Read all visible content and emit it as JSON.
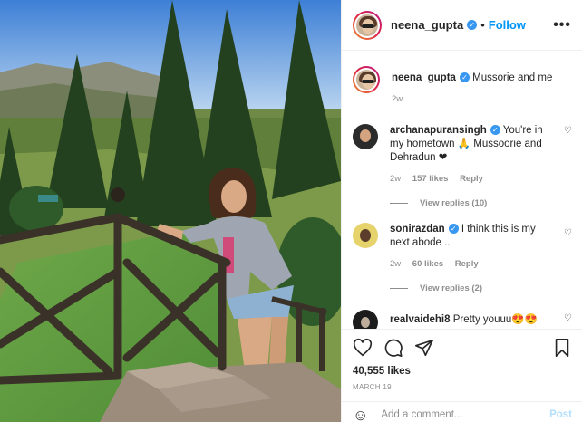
{
  "header": {
    "username": "neena_gupta",
    "dot": "•",
    "follow_label": "Follow",
    "more_label": "•••"
  },
  "caption": {
    "username": "neena_gupta",
    "text": "Mussorie and me",
    "time": "2w"
  },
  "comments": [
    {
      "username": "archanapuransingh",
      "text": "You're in my hometown 🙏 Mussoorie and Dehradun ❤",
      "time": "2w",
      "likes": "157 likes",
      "reply_label": "Reply",
      "view_replies": "View replies (10)"
    },
    {
      "username": "sonirazdan",
      "text": "I think this is my next abode ..",
      "time": "2w",
      "likes": "60 likes",
      "reply_label": "Reply",
      "view_replies": "View replies (2)"
    },
    {
      "username": "realvaidehi8",
      "text": "Pretty youuu😍😍"
    }
  ],
  "post": {
    "likes": "40,555 likes",
    "date": "MARCH 19"
  },
  "add_comment": {
    "placeholder": "Add a comment...",
    "post_label": "Post"
  },
  "colors": {
    "link": "#0095f6",
    "verified": "#3897f0",
    "muted": "#8e8e8e",
    "post_disabled": "#b2dffc"
  }
}
